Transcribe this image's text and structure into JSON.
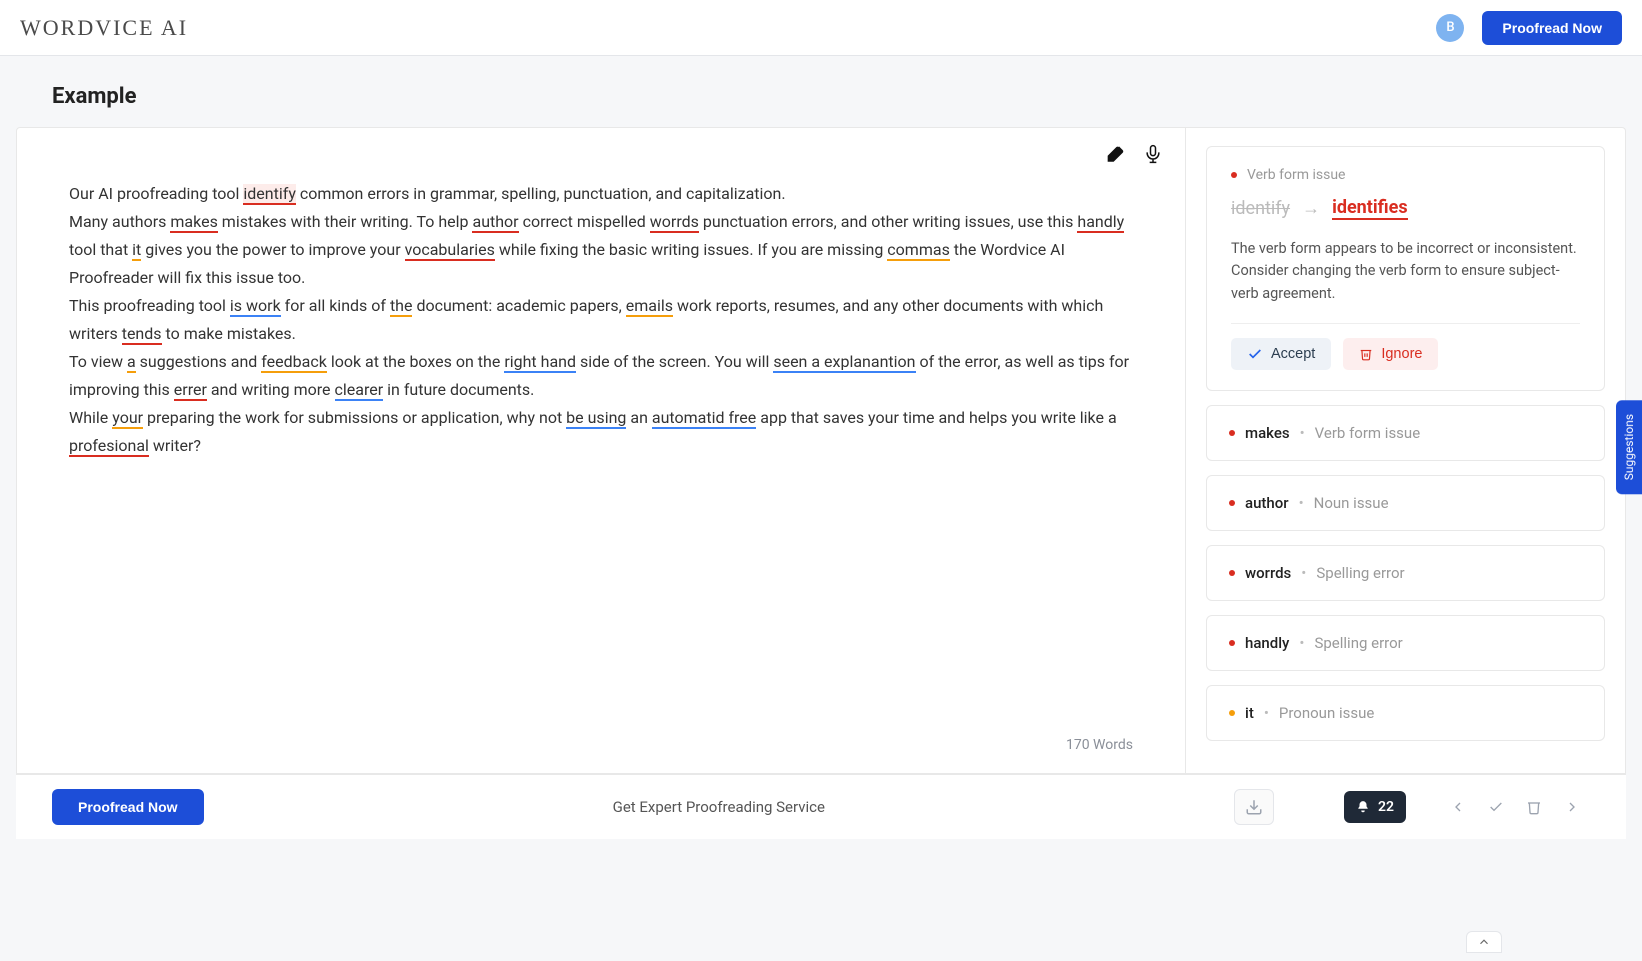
{
  "header": {
    "logo": "WORDVICE AI",
    "avatar_initial": "B",
    "proofread_btn": "Proofread Now"
  },
  "page_title": "Example",
  "editor": {
    "segments": [
      {
        "t": "Our AI proofreading tool "
      },
      {
        "t": "identify",
        "cls": "u-red-hl"
      },
      {
        "t": " common errors in grammar, spelling, punctuation, and capitalization."
      },
      {
        "br": true
      },
      {
        "t": "Many authors "
      },
      {
        "t": "makes",
        "cls": "u-red"
      },
      {
        "t": " mistakes with their writing. To help "
      },
      {
        "t": "author",
        "cls": "u-red"
      },
      {
        "t": " correct mispelled "
      },
      {
        "t": "worrds",
        "cls": "u-red"
      },
      {
        "t": " punctuation errors, and other writing issues, use this "
      },
      {
        "t": "handly",
        "cls": "u-red"
      },
      {
        "t": " tool that "
      },
      {
        "t": "it",
        "cls": "u-orange"
      },
      {
        "t": " gives you the power to improve your "
      },
      {
        "t": "vocabularies",
        "cls": "u-red"
      },
      {
        "t": " while fixing the basic writing issues. If you are missing "
      },
      {
        "t": "commas",
        "cls": "u-orange"
      },
      {
        "t": " the Wordvice AI Proofreader will fix this issue too."
      },
      {
        "br": true
      },
      {
        "t": "This proofreading tool "
      },
      {
        "t": "is work",
        "cls": "u-blue"
      },
      {
        "t": " for all kinds of "
      },
      {
        "t": "the",
        "cls": "u-orange"
      },
      {
        "t": " document: academic papers, "
      },
      {
        "t": "emails",
        "cls": "u-orange"
      },
      {
        "t": " work reports, resumes, and any other documents with which writers "
      },
      {
        "t": "tends",
        "cls": "u-red"
      },
      {
        "t": " to make mistakes."
      },
      {
        "br": true
      },
      {
        "t": "To view "
      },
      {
        "t": "a",
        "cls": "u-orange"
      },
      {
        "t": " suggestions and "
      },
      {
        "t": "feedback",
        "cls": "u-orange"
      },
      {
        "t": " look at the boxes on the "
      },
      {
        "t": "right hand",
        "cls": "u-blue"
      },
      {
        "t": " side of the screen. You will "
      },
      {
        "t": "seen a explanantion",
        "cls": "u-blue"
      },
      {
        "t": " of the error, as well as tips for improving this "
      },
      {
        "t": "errer",
        "cls": "u-red"
      },
      {
        "t": " and writing more "
      },
      {
        "t": "clearer",
        "cls": "u-blue"
      },
      {
        "t": " in future documents."
      },
      {
        "br": true
      },
      {
        "t": "While "
      },
      {
        "t": "your",
        "cls": "u-orange"
      },
      {
        "t": " preparing the work for submissions or application, why not "
      },
      {
        "t": "be using",
        "cls": "u-blue"
      },
      {
        "t": " an "
      },
      {
        "t": "automatid free",
        "cls": "u-blue"
      },
      {
        "t": " app that saves your time and helps you write like a "
      },
      {
        "t": "profesional",
        "cls": "u-red"
      },
      {
        "t": " writer?"
      }
    ],
    "word_count": "170 Words"
  },
  "suggestions": {
    "expanded": {
      "issue_label": "Verb form issue",
      "from": "identify",
      "to": "identifies",
      "description": "The verb form appears to be incorrect or inconsistent. Consider changing the verb form to ensure subject-verb agreement.",
      "accept": "Accept",
      "ignore": "Ignore"
    },
    "collapsed": [
      {
        "word": "makes",
        "type": "Verb form issue",
        "dot": "red"
      },
      {
        "word": "author",
        "type": "Noun issue",
        "dot": "red"
      },
      {
        "word": "worrds",
        "type": "Spelling error",
        "dot": "red"
      },
      {
        "word": "handly",
        "type": "Spelling error",
        "dot": "red"
      },
      {
        "word": "it",
        "type": "Pronoun issue",
        "dot": "orange"
      }
    ]
  },
  "footer": {
    "proofread_btn": "Proofread Now",
    "center_text": "Get Expert Proofreading Service",
    "notif_count": "22"
  },
  "side_tab": "Suggestions"
}
